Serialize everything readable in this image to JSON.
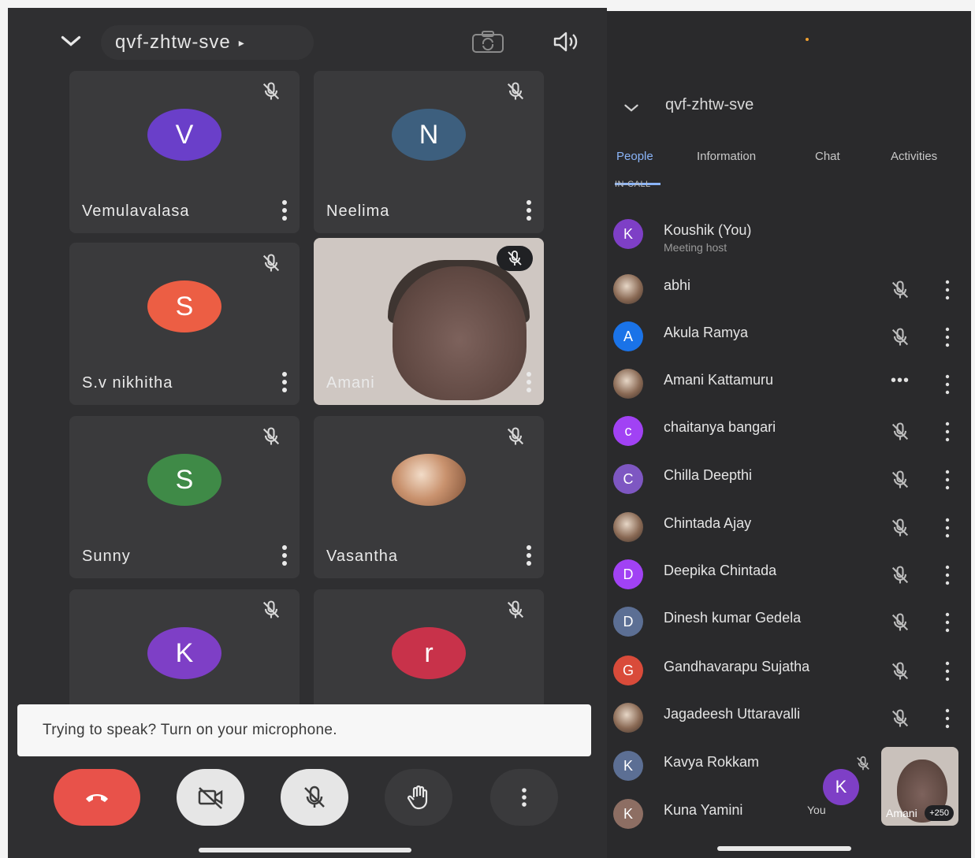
{
  "left_screen": {
    "meeting_code": "qvf-zhtw-sve",
    "participants": [
      {
        "name": "Vemulavalasa",
        "initial": "V",
        "color": "#6a3fc9"
      },
      {
        "name": "Neelima",
        "initial": "N",
        "color": "#3d5f7e"
      },
      {
        "name": "S.v nikhitha",
        "initial": "S",
        "color": "#ec5e44"
      },
      {
        "name": "Amani",
        "initial": "",
        "color": ""
      },
      {
        "name": "Sunny",
        "initial": "S",
        "color": "#3f8a47"
      },
      {
        "name": "Vasantha",
        "initial": "",
        "color": ""
      },
      {
        "name": "",
        "initial": "K",
        "color": "#7e3fc6"
      },
      {
        "name": "",
        "initial": "r",
        "color": "#c8324a"
      }
    ],
    "toast": "Trying to speak? Turn on your microphone.",
    "controls": {
      "end_color": "#e8524a"
    }
  },
  "right_screen": {
    "meeting_code": "qvf-zhtw-sve",
    "tabs": [
      "People",
      "Information",
      "Chat",
      "Activities"
    ],
    "active_tab": "People",
    "section_label": "IN-CALL",
    "people": [
      {
        "name": "Koushik (You)",
        "subtitle": "Meeting host",
        "initial": "K",
        "color": "#7e3fc6",
        "status": "none"
      },
      {
        "name": "abhi",
        "initial": "",
        "color": "",
        "status": "muted"
      },
      {
        "name": "Akula Ramya",
        "initial": "A",
        "color": "#1a73e8",
        "status": "muted"
      },
      {
        "name": "Amani Kattamuru",
        "initial": "",
        "color": "",
        "status": "speaking"
      },
      {
        "name": "chaitanya bangari",
        "initial": "c",
        "color": "#a142f4",
        "status": "muted"
      },
      {
        "name": "Chilla Deepthi",
        "initial": "C",
        "color": "#7e57c2",
        "status": "muted"
      },
      {
        "name": "Chintada Ajay",
        "initial": "",
        "color": "",
        "status": "muted"
      },
      {
        "name": "Deepika Chintada",
        "initial": "D",
        "color": "#a142f4",
        "status": "muted"
      },
      {
        "name": "Dinesh kumar Gedela",
        "initial": "D",
        "color": "#5c6f94",
        "status": "muted"
      },
      {
        "name": "Gandhavarapu Sujatha",
        "initial": "G",
        "color": "#d94b3a",
        "status": "muted"
      },
      {
        "name": "Jagadeesh Uttaravalli",
        "initial": "",
        "color": "",
        "status": "muted"
      },
      {
        "name": "Kavya Rokkam",
        "initial": "K",
        "color": "#5c6f94",
        "status": "none"
      },
      {
        "name": "Kuna Yamini",
        "initial": "K",
        "color": "#8d6e63",
        "status": "none"
      }
    ],
    "self_tile": {
      "initial": "K",
      "label": "You"
    },
    "pinned_tile": {
      "name": "Amani",
      "count": "+250"
    }
  }
}
